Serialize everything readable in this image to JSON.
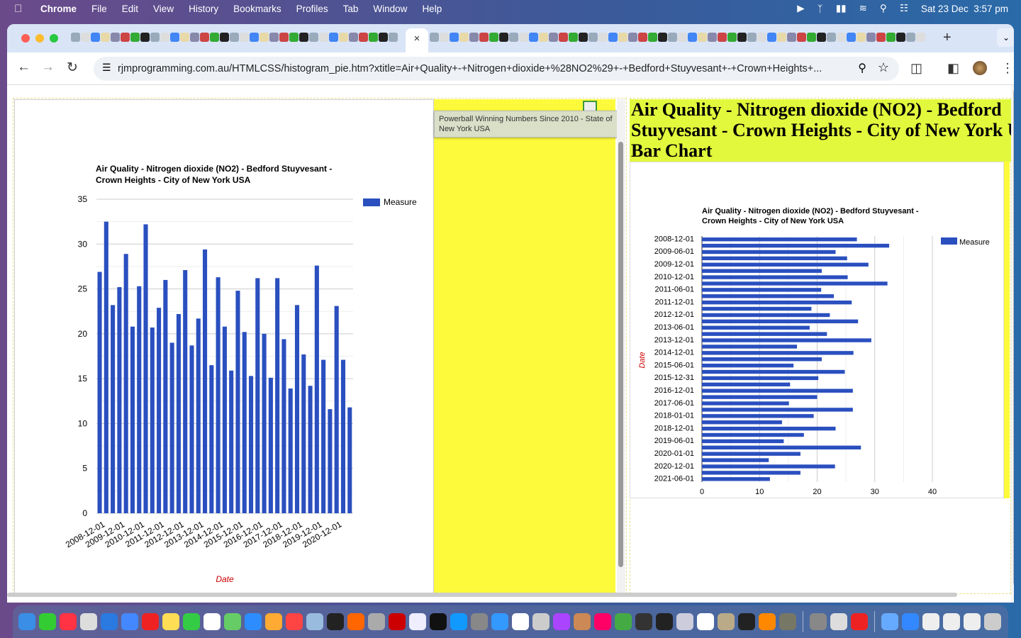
{
  "menubar": {
    "app": "Chrome",
    "items": [
      "File",
      "Edit",
      "View",
      "History",
      "Bookmarks",
      "Profiles",
      "Tab",
      "Window",
      "Help"
    ],
    "clock": "Sat 23 Dec  3:57 pm"
  },
  "browser": {
    "url": "rjmprogramming.com.au/HTMLCSS/histogram_pie.htm?xtitle=Air+Quality+-+Nitrogen+dioxide+%28NO2%29+-+Bedford+Stuyvesant+-+Crown+Heights+...",
    "active_tab_close": "×",
    "new_tab": "+"
  },
  "tooltip": "Powerball Winning Numbers Since 2010 - State of New York USA",
  "right_header": {
    "line1": "Air Quality - Nitrogen dioxide (NO2) - Bedford",
    "line2": "Stuyvesant - Crown Heights - City of New York U",
    "line3": "Bar Chart"
  },
  "colors": {
    "bar": "#2a4fbf",
    "yellow": "#fcfa3a",
    "header": "#e2f83c",
    "axis_title": "#cc0000"
  },
  "chart_data": [
    {
      "type": "bar",
      "orientation": "vertical",
      "title": "Air Quality - Nitrogen dioxide (NO2) - Bedford Stuyvesant - Crown Heights - City of New York USA",
      "xlabel": "Date",
      "ylabel": "",
      "legend": {
        "name": "Measure",
        "position": "right"
      },
      "ylim": [
        0,
        35
      ],
      "yticks": [
        0,
        5,
        10,
        15,
        20,
        25,
        30,
        35
      ],
      "grid": true,
      "xtick_labels": [
        "2008-12-01",
        "2009-12-01",
        "2010-12-01",
        "2011-12-01",
        "2012-12-01",
        "2013-12-01",
        "2014-12-01",
        "2015-12-01",
        "2016-12-01",
        "2017-12-01",
        "2018-12-01",
        "2019-12-01",
        "2020-12-01"
      ],
      "series": [
        {
          "name": "Measure",
          "values": [
            26.9,
            32.5,
            23.2,
            25.2,
            28.9,
            20.8,
            25.3,
            32.2,
            20.7,
            22.9,
            26.0,
            19.0,
            22.2,
            27.1,
            18.7,
            21.7,
            29.4,
            16.5,
            26.3,
            20.8,
            15.9,
            24.8,
            20.2,
            15.3,
            26.2,
            20.0,
            15.1,
            26.2,
            19.4,
            13.9,
            23.2,
            17.7,
            14.2,
            27.6,
            17.1,
            11.6,
            23.1,
            17.1,
            11.8
          ]
        }
      ]
    },
    {
      "type": "bar",
      "orientation": "horizontal",
      "title": "Air Quality - Nitrogen dioxide (NO2) - Bedford Stuyvesant - Crown Heights - City of New York USA",
      "xlabel": "",
      "ylabel": "Date",
      "legend": {
        "name": "Measure",
        "position": "right"
      },
      "xlim": [
        0,
        40
      ],
      "xticks": [
        0,
        10,
        20,
        30,
        40
      ],
      "grid": true,
      "ytick_labels": [
        "2008-12-01",
        "2009-06-01",
        "2009-12-01",
        "2010-12-01",
        "2011-06-01",
        "2011-12-01",
        "2012-12-01",
        "2013-06-01",
        "2013-12-01",
        "2014-12-01",
        "2015-06-01",
        "2015-12-31",
        "2016-12-01",
        "2017-06-01",
        "2018-01-01",
        "2018-12-01",
        "2019-06-01",
        "2020-01-01",
        "2020-12-01",
        "2021-06-01"
      ],
      "series": [
        {
          "name": "Measure",
          "values": [
            26.9,
            32.5,
            23.2,
            25.2,
            28.9,
            20.8,
            25.3,
            32.2,
            20.7,
            22.9,
            26.0,
            19.0,
            22.2,
            27.1,
            18.7,
            21.7,
            29.4,
            16.5,
            26.3,
            20.8,
            15.9,
            24.8,
            20.2,
            15.3,
            26.2,
            20.0,
            15.1,
            26.2,
            19.4,
            13.9,
            23.2,
            17.7,
            14.2,
            27.6,
            17.1,
            11.6,
            23.1,
            17.1,
            11.8
          ]
        }
      ]
    }
  ],
  "dock": [
    "finder",
    "messages",
    "music",
    "launchpad",
    "safari",
    "mail",
    "opera",
    "notes",
    "facetime",
    "textedit",
    "maps",
    "zoom",
    "photos",
    "news",
    "preview",
    "terminal",
    "firefox",
    "launchpad2",
    "filezilla",
    "bbedit",
    "appletv",
    "appstore",
    "calculator",
    "xcode",
    "calendar",
    "photo-booth",
    "podcasts",
    "books",
    "intellij",
    "chrome",
    "inkscape",
    "terminal2",
    "quicktime",
    "textedit2",
    "colorsync",
    "terminal3",
    "vlc",
    "gimp",
    "settings",
    "script-editor",
    "opera2",
    "folder",
    "network",
    "window1",
    "window2",
    "window3",
    "trash"
  ]
}
